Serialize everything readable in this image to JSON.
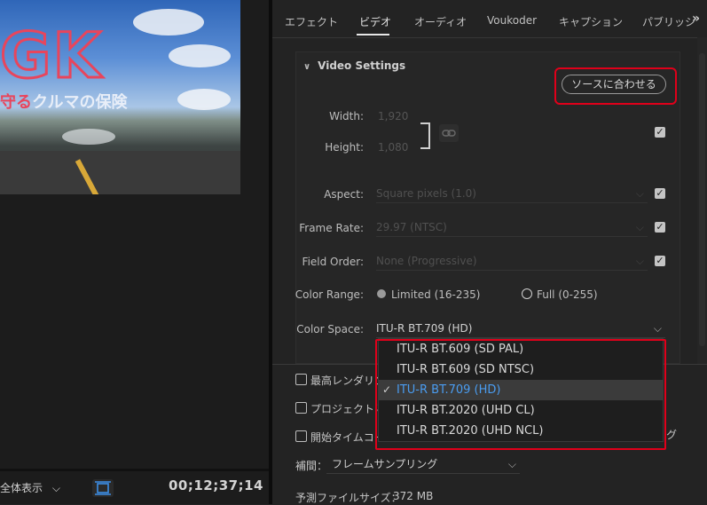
{
  "preview": {
    "logo_text": "GK",
    "caption_red": "守る",
    "caption_rest": "クルマの保険",
    "zoom_label": "全体表示",
    "timecode": "00;12;37;14"
  },
  "tabs": [
    {
      "label": "エフェクト"
    },
    {
      "label": "ビデオ"
    },
    {
      "label": "オーディオ"
    },
    {
      "label": "Voukoder"
    },
    {
      "label": "キャプション"
    },
    {
      "label": "パブリッシ..."
    }
  ],
  "more_tabs": "»",
  "video_settings": {
    "header": "Video Settings",
    "match_source": "ソースに合わせる",
    "width_label": "Width:",
    "width_value": "1,920",
    "height_label": "Height:",
    "height_value": "1,080",
    "aspect_label": "Aspect:",
    "aspect_value": "Square pixels (1.0)",
    "frame_rate_label": "Frame Rate:",
    "frame_rate_value": "29.97 (NTSC)",
    "field_order_label": "Field Order:",
    "field_order_value": "None (Progressive)",
    "color_range_label": "Color Range:",
    "color_range_limited": "Limited (16-235)",
    "color_range_full": "Full (0-255)",
    "color_space_label": "Color Space:",
    "color_space_value": "ITU-R BT.709 (HD)"
  },
  "color_space_options": [
    {
      "label": "ITU-R BT.609 (SD PAL)"
    },
    {
      "label": "ITU-R BT.609 (SD NTSC)"
    },
    {
      "label": "ITU-R BT.709 (HD)"
    },
    {
      "label": "ITU-R BT.2020 (UHD CL)"
    },
    {
      "label": "ITU-R BT.2020 (UHD NCL)"
    }
  ],
  "lower": {
    "max_render_label": "最高レンダリン",
    "project_label": "プロジェクトに",
    "start_timecode_label": "開始タイムコー",
    "trailing_suffix": "グ",
    "interp_label": "補間：",
    "interp_value": "フレームサンプリング",
    "file_size_label": "予測ファイルサイズ：",
    "file_size_value": "372 MB"
  },
  "colors": {
    "highlight": "#e0001a",
    "selected_option": "#4a9cf0",
    "logo": "#e8455c"
  }
}
